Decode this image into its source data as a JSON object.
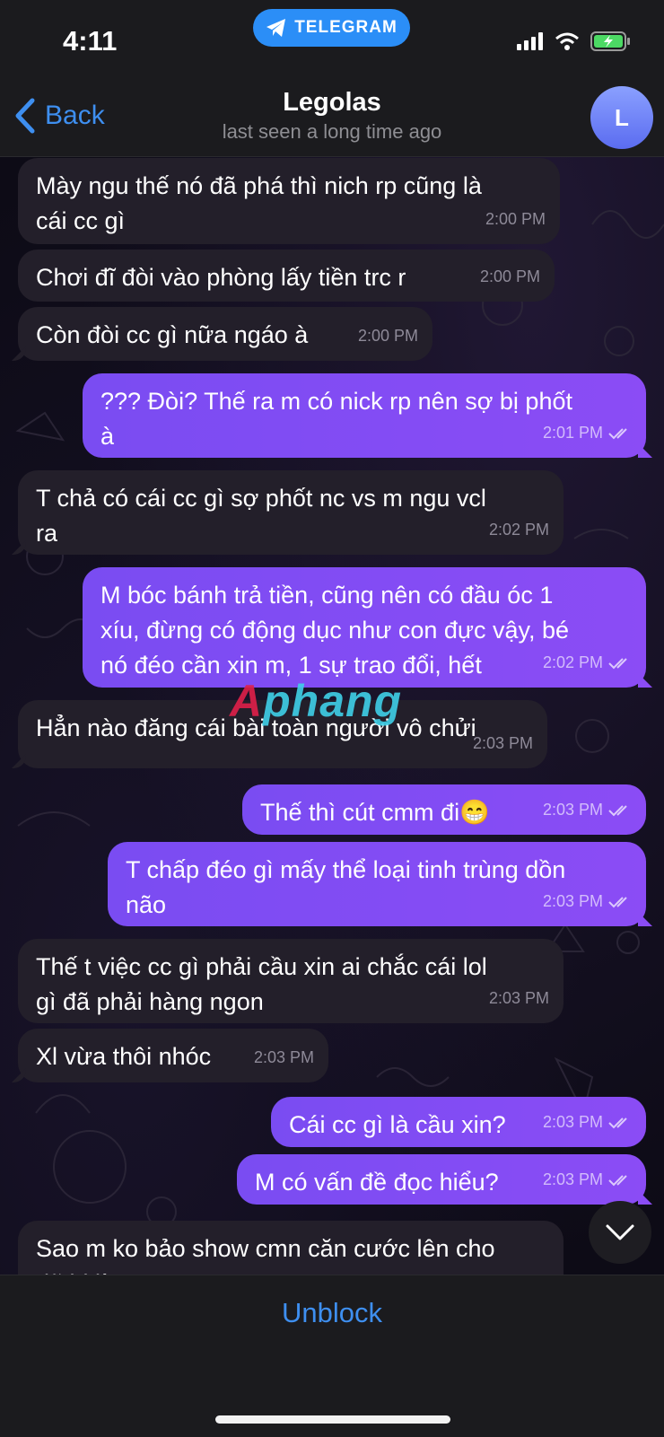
{
  "status_bar": {
    "time": "4:11",
    "app_pill": "TELEGRAM",
    "accent": "#2b8ef7"
  },
  "header": {
    "back_label": "Back",
    "contact_name": "Legolas",
    "contact_status": "last seen a long time ago",
    "avatar_initial": "L"
  },
  "colors": {
    "incoming_bubble": "#231f2a",
    "outgoing_bubble": "#8b4cf5",
    "link_blue": "#3e8ff0"
  },
  "messages": [
    {
      "dir": "in",
      "text": "Mày ngu thế nó đã phá thì nich rp cũng là\ncái cc gì",
      "time": "2:00 PM"
    },
    {
      "dir": "in",
      "text": "Chơi đĩ đòi vào phòng lấy tiền trc r",
      "time": "2:00 PM"
    },
    {
      "dir": "in",
      "text": "Còn đòi cc gì nữa ngáo à",
      "time": "2:00 PM"
    },
    {
      "dir": "out",
      "text": "??? Đòi? Thế ra m có nick rp nên sợ bị phốt\nà",
      "time": "2:01 PM"
    },
    {
      "dir": "in",
      "text": "T chả có cái cc gì sợ phốt nc vs m ngu vcl\nra",
      "time": "2:02 PM"
    },
    {
      "dir": "out",
      "text": "M bóc bánh trả tiền, cũng nên có đầu óc 1\nxíu, đừng có động dục như con đực vậy, bé\nnó đéo cần xin m, 1 sự trao đổi, hết",
      "time": "2:02 PM"
    },
    {
      "dir": "in",
      "text": "Hẳn nào đăng cái bài toàn người vô chửi",
      "time": "2:03 PM"
    },
    {
      "dir": "out",
      "text": "Thế thì cút cmm đi😁",
      "time": "2:03 PM"
    },
    {
      "dir": "out",
      "text": "T chấp đéo gì mấy thể loại tinh trùng dồn\nnão",
      "time": "2:03 PM"
    },
    {
      "dir": "in",
      "text": "Thế t việc cc gì phải cầu xin ai chắc cái lol\ngì đã phải hàng ngon",
      "time": "2:03 PM"
    },
    {
      "dir": "in",
      "text": "Xl vừa thôi nhóc",
      "time": "2:03 PM"
    },
    {
      "dir": "out",
      "text": "Cái cc gì là cầu xin?",
      "time": "2:03 PM"
    },
    {
      "dir": "out",
      "text": "M có vấn đề đọc hiểu?",
      "time": "2:03 PM"
    },
    {
      "dir": "in",
      "text": "Sao m ko bảo show cmn căn cước lên cho\nđã bị lừa",
      "time": ""
    }
  ],
  "watermark": {
    "first": "A",
    "rest": "phang"
  },
  "bottom": {
    "unblock_label": "Unblock"
  }
}
